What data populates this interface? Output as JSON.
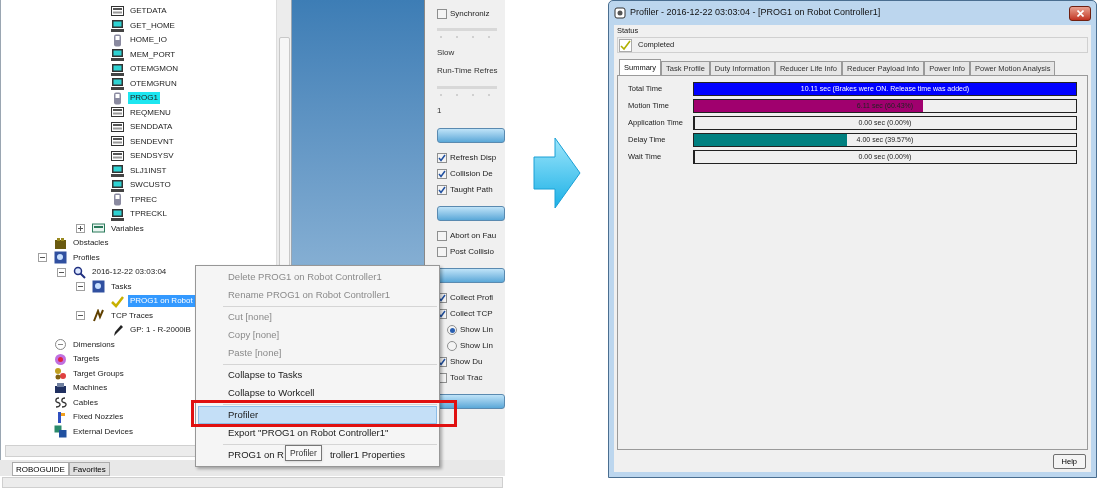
{
  "tree": {
    "programs": [
      {
        "label": "GETDATA",
        "kind": "module",
        "selected": false
      },
      {
        "label": "GET_HOME",
        "kind": "monitor",
        "selected": false
      },
      {
        "label": "HOME_IO",
        "kind": "pendant",
        "selected": false
      },
      {
        "label": "MEM_PORT",
        "kind": "monitor",
        "selected": false
      },
      {
        "label": "OTEMGMON",
        "kind": "monitor",
        "selected": false
      },
      {
        "label": "OTEMGRUN",
        "kind": "monitor",
        "selected": false
      },
      {
        "label": "PROG1",
        "kind": "pendant",
        "selected": true
      },
      {
        "label": "REQMENU",
        "kind": "module",
        "selected": false
      },
      {
        "label": "SENDDATA",
        "kind": "module",
        "selected": false
      },
      {
        "label": "SENDEVNT",
        "kind": "module",
        "selected": false
      },
      {
        "label": "SENDSYSV",
        "kind": "module",
        "selected": false
      },
      {
        "label": "SLJ1INST",
        "kind": "monitor",
        "selected": false
      },
      {
        "label": "SWCUSTO",
        "kind": "monitor",
        "selected": false
      },
      {
        "label": "TPREC",
        "kind": "pendant",
        "selected": false
      },
      {
        "label": "TPRECKL",
        "kind": "monitor",
        "selected": false
      }
    ],
    "variables": {
      "label": "Variables",
      "kind": "variables",
      "expanded": false,
      "selected": false
    },
    "items": [
      {
        "label": "Obstacles",
        "kind": "obstacle",
        "selected": false
      },
      {
        "label": "Profiles",
        "kind": "profile",
        "expanded": true,
        "selected": false,
        "children": [
          {
            "label": "2016-12-22 03:03:04",
            "kind": "magnifier",
            "expanded": true,
            "selected": false,
            "children": [
              {
                "label": "Tasks",
                "kind": "profile",
                "expanded": true,
                "selected": false,
                "children": [
                  {
                    "label": "PROG1 on Robot",
                    "kind": "check",
                    "selected": true
                  }
                ]
              },
              {
                "label": "TCP Traces",
                "kind": "trace",
                "expanded": true,
                "selected": false,
                "children": [
                  {
                    "label": "GP: 1 - R-2000iB",
                    "kind": "pen",
                    "selected": false
                  }
                ]
              }
            ]
          }
        ]
      },
      {
        "label": "Dimensions",
        "kind": "dimension",
        "selected": false
      },
      {
        "label": "Targets",
        "kind": "target",
        "selected": false
      },
      {
        "label": "Target Groups",
        "kind": "group",
        "selected": false
      },
      {
        "label": "Machines",
        "kind": "machine",
        "selected": false
      },
      {
        "label": "Cables",
        "kind": "cable",
        "selected": false
      },
      {
        "label": "Fixed Nozzles",
        "kind": "nozzle",
        "selected": false
      },
      {
        "label": "External Devices",
        "kind": "device",
        "selected": false
      }
    ]
  },
  "bottom_tabs": [
    {
      "label": "ROBOGUIDE",
      "selected": true
    },
    {
      "label": "Favorites",
      "selected": false
    }
  ],
  "options_panel": [
    {
      "kind": "checkbox",
      "label": "Synchroniz",
      "checked": false
    },
    {
      "kind": "track"
    },
    {
      "kind": "text",
      "label": "Slow"
    },
    {
      "kind": "text",
      "label": "Run-Time Refres"
    },
    {
      "kind": "track"
    },
    {
      "kind": "text",
      "label": "1"
    },
    {
      "kind": "bar"
    },
    {
      "kind": "checkbox",
      "label": "Refresh Disp",
      "checked": true
    },
    {
      "kind": "checkbox",
      "label": "Collision De",
      "checked": true
    },
    {
      "kind": "checkbox",
      "label": "Taught Path",
      "checked": true
    },
    {
      "kind": "bar"
    },
    {
      "kind": "checkbox",
      "label": "Abort on Fau",
      "checked": false
    },
    {
      "kind": "checkbox",
      "label": "Post Collisio",
      "checked": false
    },
    {
      "kind": "bar"
    },
    {
      "kind": "checkbox",
      "label": "Collect Profi",
      "checked": true
    },
    {
      "kind": "checkbox",
      "label": "Collect TCP",
      "checked": true
    },
    {
      "kind": "radio",
      "label": "Show Lin",
      "selected": true
    },
    {
      "kind": "radio",
      "label": "Show Lin",
      "selected": false
    },
    {
      "kind": "checkbox",
      "label": "Show Du",
      "checked": true
    },
    {
      "kind": "checkbox",
      "label": "Tool Trac",
      "checked": false
    },
    {
      "kind": "bar"
    }
  ],
  "context_menu": [
    {
      "kind": "item",
      "label": "Delete PROG1 on Robot Controller1",
      "disabled": true,
      "selected": false
    },
    {
      "kind": "item",
      "label": "Rename PROG1 on Robot Controller1",
      "disabled": true,
      "selected": false
    },
    {
      "kind": "separator"
    },
    {
      "kind": "item",
      "label": "Cut [none]",
      "disabled": true,
      "selected": false
    },
    {
      "kind": "item",
      "label": "Copy [none]",
      "disabled": true,
      "selected": false
    },
    {
      "kind": "item",
      "label": "Paste [none]",
      "disabled": true,
      "selected": false
    },
    {
      "kind": "separator"
    },
    {
      "kind": "item",
      "label": "Collapse to Tasks",
      "disabled": false,
      "selected": false
    },
    {
      "kind": "item",
      "label": "Collapse to Workcell",
      "disabled": false,
      "selected": false
    },
    {
      "kind": "separator"
    },
    {
      "kind": "item",
      "label": "Profiler",
      "disabled": false,
      "selected": true,
      "marked": true
    },
    {
      "kind": "item",
      "label": "Export \"PROG1 on Robot Controller1\"",
      "disabled": false,
      "selected": false
    },
    {
      "kind": "separator"
    },
    {
      "kind": "split",
      "label": "PROG1 on R",
      "label_end": "troller1 Properties",
      "disabled": false,
      "selected": false
    }
  ],
  "tooltip": "Profiler",
  "profiler": {
    "title": "Profiler - 2016-12-22 03:03:04 - [PROG1 on Robot Controller1]",
    "status_label": "Status",
    "status": "Completed",
    "tabs": [
      {
        "label": "Summary",
        "selected": true
      },
      {
        "label": "Task Profile",
        "selected": false
      },
      {
        "label": "Duty Information",
        "selected": false
      },
      {
        "label": "Reducer Life Info",
        "selected": false
      },
      {
        "label": "Reducer Payload Info",
        "selected": false
      },
      {
        "label": "Power Info",
        "selected": false
      },
      {
        "label": "Power Motion Analysis",
        "selected": false
      }
    ],
    "rows": [
      {
        "label": "Total Time",
        "level": 1,
        "color": "#0000ff",
        "reading": "10.11 sec (Brakes were ON. Release time was added)"
      },
      {
        "label": "Motion Time",
        "level": 0.6,
        "color": "#a0006e",
        "reading": "6.11 sec (60.43%)"
      },
      {
        "label": "Application Time",
        "level": 0,
        "reading": "0.00 sec (0.00%)"
      },
      {
        "label": "Delay Time",
        "level": 0.4,
        "color": "#008080",
        "reading": "4.00 sec (39.57%)"
      },
      {
        "label": "Wait Time",
        "level": 0,
        "reading": "0.00 sec (0.00%)"
      }
    ],
    "help": "Help"
  }
}
